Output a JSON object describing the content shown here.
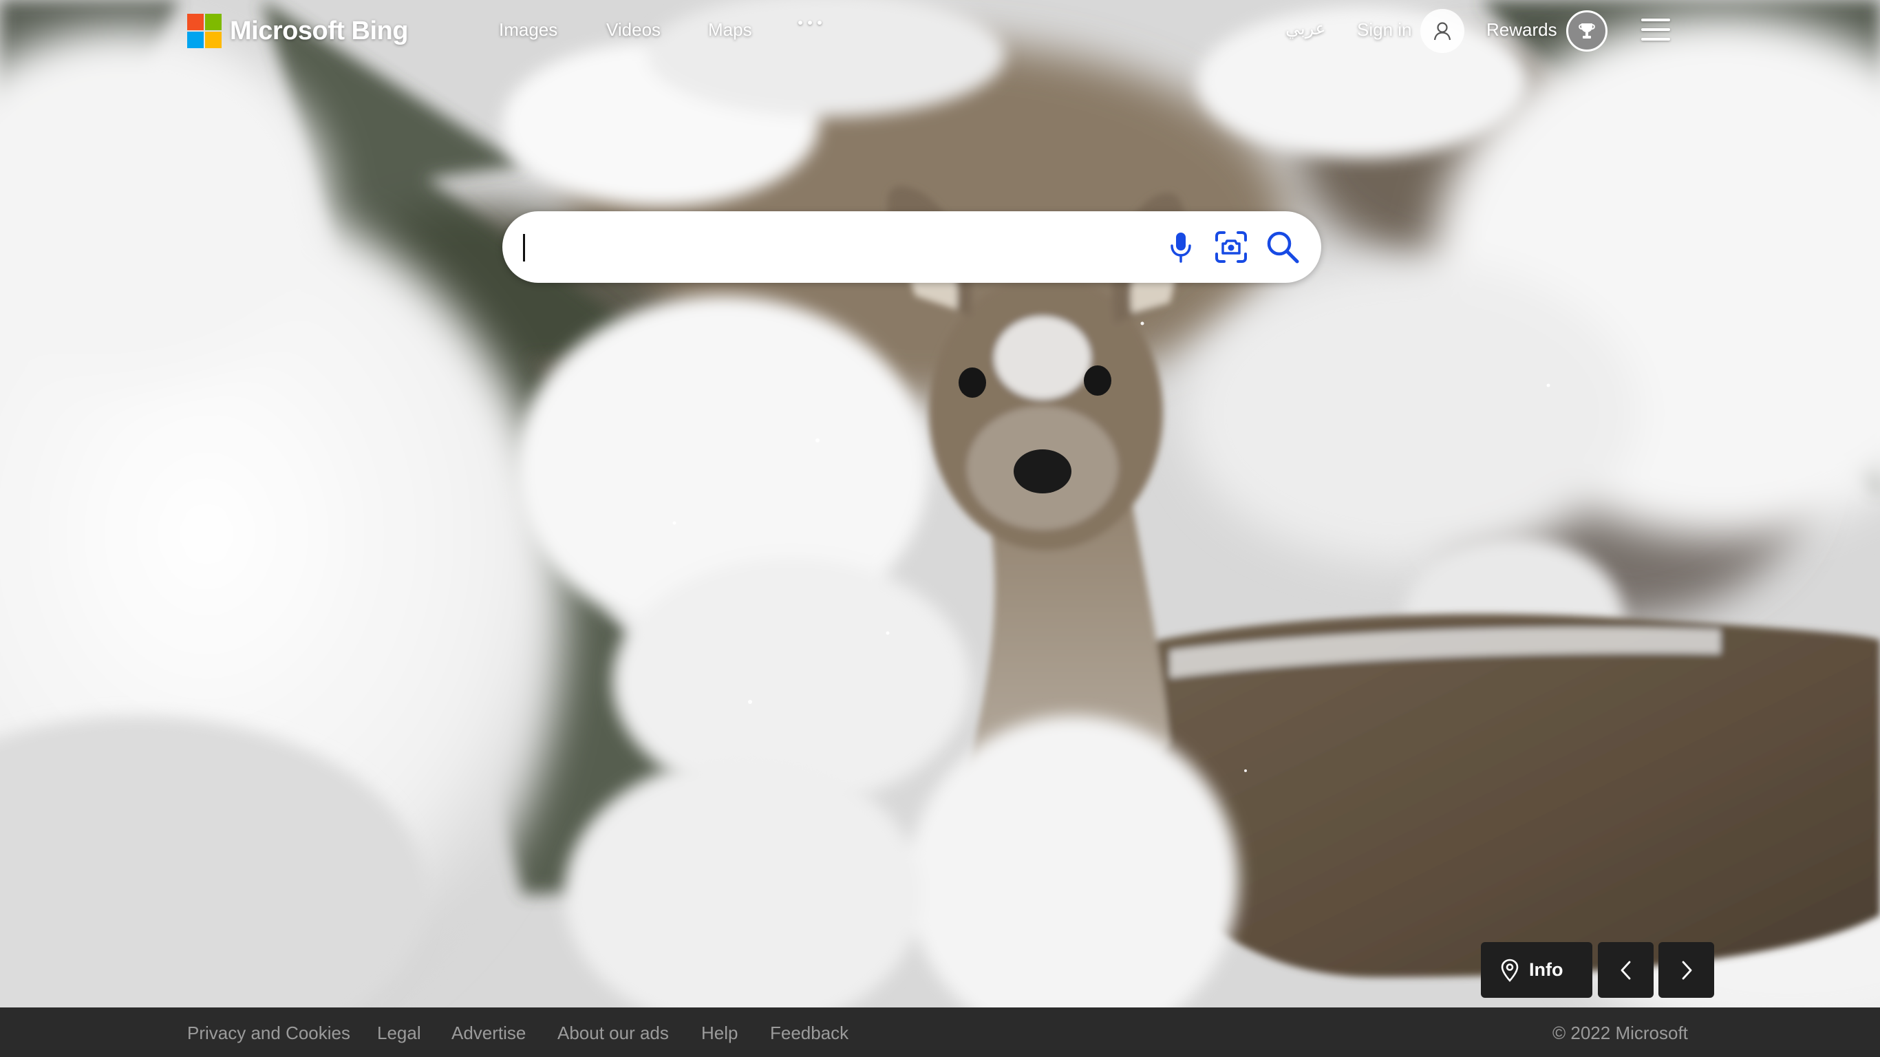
{
  "header": {
    "logo_text": "Microsoft Bing",
    "logo_colors": [
      "#f25022",
      "#7fba00",
      "#00a4ef",
      "#ffb900"
    ],
    "nav": [
      {
        "label": "Images"
      },
      {
        "label": "Videos"
      },
      {
        "label": "Maps"
      }
    ],
    "more_icon": "more-dots-icon",
    "language_link": "عربي",
    "sign_in_label": "Sign in",
    "avatar_icon": "person-icon",
    "rewards_label": "Rewards",
    "rewards_icon": "trophy-icon",
    "menu_icon": "hamburger-menu-icon"
  },
  "search": {
    "value": "",
    "placeholder": "",
    "icons": [
      "microphone-icon",
      "visual-search-icon",
      "search-icon"
    ]
  },
  "image_controls": {
    "info_label": "Info",
    "info_icon": "location-pin-icon",
    "prev_icon": "chevron-left-icon",
    "next_icon": "chevron-right-icon"
  },
  "footer": {
    "links": [
      {
        "label": "Privacy and Cookies"
      },
      {
        "label": "Legal"
      },
      {
        "label": "Advertise"
      },
      {
        "label": "About our ads"
      },
      {
        "label": "Help"
      },
      {
        "label": "Feedback"
      }
    ],
    "copyright": "© 2022 Microsoft"
  },
  "colors": {
    "footer_bg": "#2b2b2b",
    "footer_text": "#9b9b9b",
    "control_bg": "#1f1f1f",
    "header_text": "#ffffff"
  }
}
